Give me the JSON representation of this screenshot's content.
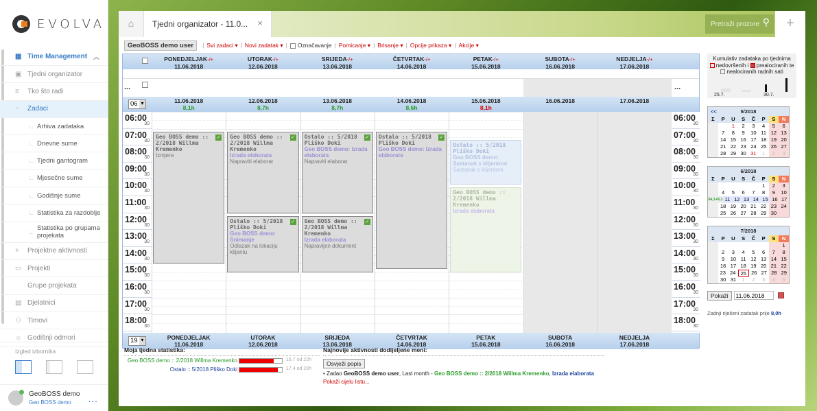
{
  "brand": {
    "name": "EVOLVA"
  },
  "sidebar": {
    "section": "Time Management",
    "items": [
      {
        "label": "Tjedni organizator",
        "type": "top-sub",
        "icon": "calendar-check-icon"
      },
      {
        "label": "Tko što radi",
        "type": "top-sub",
        "icon": "list-icon"
      },
      {
        "label": "Zadaci",
        "type": "active",
        "icon": "minus-icon"
      },
      {
        "label": "Arhiva zadataka",
        "type": "sub"
      },
      {
        "label": "Dnevne sume",
        "type": "sub"
      },
      {
        "label": "Tjedni gantogram",
        "type": "sub"
      },
      {
        "label": "Mjesečne sume",
        "type": "sub"
      },
      {
        "label": "Godišnje sume",
        "type": "sub"
      },
      {
        "label": "Statistika za razdoblje",
        "type": "sub"
      },
      {
        "label": "Statistika po grupama projekata",
        "type": "sub"
      },
      {
        "label": "Projektne aktivnosti",
        "type": "top-sub",
        "icon": "plus-icon"
      },
      {
        "label": "Projekti",
        "type": "top-sub",
        "icon": "projects-icon"
      },
      {
        "label": "Grupe projekata",
        "type": "top-sub",
        "icon": ""
      },
      {
        "label": "Djelatnici",
        "type": "top-sub",
        "icon": "employee-icon"
      },
      {
        "label": "Timovi",
        "type": "top-sub",
        "icon": "team-icon"
      },
      {
        "label": "Godišnji odmori",
        "type": "top-sub",
        "icon": "sun-icon"
      }
    ],
    "layout_label": "Izgled izbornika",
    "user": {
      "name": "GeoBOSS demo",
      "sub": "Geo BOSS demo",
      "more": "..."
    }
  },
  "tabs": {
    "title": "Tjedni organizator - 11.0...",
    "close": "×",
    "search_placeholder": "Pretraži prozore",
    "add": "+"
  },
  "toolbar": {
    "user": "GeoBOSS demo user",
    "items": [
      "Svi zadaci ▾",
      "Novi zadatak ▾",
      "Označavanje",
      "Pomicanje ▾",
      "Brisanje ▾",
      "Opcije prikaza ▾",
      "Akcije ▾"
    ]
  },
  "days": [
    {
      "name": "PONEDJELJAK",
      "date": "11.06.2018",
      "hours": "8,1h",
      "hcolor": "g"
    },
    {
      "name": "UTORAK",
      "date": "12.06.2018",
      "hours": "8,7h",
      "hcolor": "g"
    },
    {
      "name": "SRIJEDA",
      "date": "13.06.2018",
      "hours": "8,7h",
      "hcolor": "g"
    },
    {
      "name": "ČETVRTAK",
      "date": "14.06.2018",
      "hours": "8,6h",
      "hcolor": "g"
    },
    {
      "name": "PETAK",
      "date": "15.06.2018",
      "hours": "8,1h",
      "hcolor": "r"
    },
    {
      "name": "SUBOTA",
      "date": "16.06.2018",
      "hours": "",
      "hcolor": "g"
    },
    {
      "name": "NEDJELJA",
      "date": "17.06.2018",
      "hours": "",
      "hcolor": "g"
    }
  ],
  "footer_days": [
    "PONEDJELJAK",
    "UTORAK",
    "SRIJEDA",
    "ČETVRTAK",
    "PETAK",
    "SUBOTA",
    "NEDJELJA"
  ],
  "adj": "-/+",
  "dots": "...",
  "start_hour_select": "06",
  "end_hour_select": "19",
  "hours": [
    "06:00",
    "07:00",
    "08:00",
    "09:00",
    "10:00",
    "11:00",
    "12:00",
    "13:00",
    "14:00",
    "15:00",
    "16:00",
    "17:00",
    "18:00"
  ],
  "half": "30",
  "tasks": [
    {
      "day": 0,
      "start": 7.0,
      "end": 15.0,
      "title": "Geo BOSS demo :: 2/2018 Willma Kremenko",
      "label": "",
      "desc": "Izmjera",
      "ok": true,
      "style": ""
    },
    {
      "day": 1,
      "start": 7.0,
      "end": 12.0,
      "title": "Geo BOSS demo :: 2/2018 Willma Kremenko",
      "label": "Izrada elaborata",
      "desc": "Napraviti elaborat",
      "ok": true,
      "style": ""
    },
    {
      "day": 1,
      "start": 12.0,
      "end": 15.5,
      "title": "Ostalo :: 5/2018 Pliško Doki",
      "label": "Geo BOSS demo: Snimanje",
      "desc": "Odlazak na lokaciju klijentu",
      "ok": true,
      "style": ""
    },
    {
      "day": 2,
      "start": 7.0,
      "end": 12.0,
      "title": "Ostalo :: 5/2018 Pliško Doki",
      "label": "Geo BOSS demo: Izrada elaborata",
      "desc": "Napraviti elaborat",
      "ok": true,
      "style": ""
    },
    {
      "day": 2,
      "start": 12.0,
      "end": 15.5,
      "title": "Geo BOSS demo :: 2/2018 Willma Kremenko",
      "label": "Izrada elaborata",
      "desc": "Napravljen dokument",
      "ok": true,
      "style": ""
    },
    {
      "day": 3,
      "start": 7.0,
      "end": 15.3,
      "title": "Ostalo :: 5/2018 Pliško Doki",
      "label": "Geo BOSS demo: Izrada elaborata",
      "desc": "",
      "ok": true,
      "style": ""
    },
    {
      "day": 4,
      "start": 7.5,
      "end": 10.3,
      "title": "Ostalo :: 5/2018 Pliško Doki",
      "label": "Geo BOSS demo: Sastanak s klijentom",
      "desc": "Sastanak s klijentom",
      "ok": false,
      "style": "light"
    },
    {
      "day": 4,
      "start": 10.3,
      "end": 15.5,
      "title": "Geo BOSS demo :: 2/2018 Willma Kremenko",
      "label": "Izrada elaborata",
      "desc": "",
      "ok": false,
      "style": "lg"
    }
  ],
  "stats": {
    "title": "Moja tjedna statistika:",
    "rows": [
      {
        "label": "Geo BOSS demo :: 2/2018 Willma Kremenko",
        "fraction": 0.8,
        "value": "16.7 od 22h",
        "color": "#2a9a2a"
      },
      {
        "label": "Ostalo :: 5/2018 Pliško Doki",
        "fraction": 0.9,
        "value": "17.4 od 20h",
        "color": "#1a3f9a"
      }
    ]
  },
  "activity": {
    "title": "Najnovije aktivnosti dodijeljene meni:",
    "refresh": "Osvježi popis",
    "line_prefix": "• Zadao ",
    "line_user": "GeoBOSS demo user",
    "line_mid": ", Last month - ",
    "line_proj": "Geo BOSS demo :: 2/2018 Willma Kremenko",
    "line_sep": ", ",
    "line_task": "Izrada elaborata",
    "show_all": "Pokaži cijelu listu..."
  },
  "right": {
    "cumul_title": "Kumulativ zadataka po tjednima",
    "legend1": "nedovršenih i",
    "legend2": "prealociranih te",
    "legend3": "nealociranih radnih sati",
    "bar_labels": [
      "25.7.",
      "30.7."
    ],
    "bar_levels": [
      0.2,
      0.1,
      0.5,
      0.9
    ],
    "show_btn": "Pokaži",
    "date_value": "11.06.2018",
    "last_solved": "Zadnji riješeni zadatak prije",
    "last_solved_val": "8,0h",
    "cal_nav": "<<",
    "dow": [
      "Σ",
      "P",
      "U",
      "S",
      "Č",
      "P",
      "S",
      "N"
    ],
    "cal5_title": "5/2018",
    "cal5": [
      [
        "",
        "",
        "1",
        "2",
        "3",
        "4",
        "5",
        "6"
      ],
      [
        "",
        "7",
        "8",
        "9",
        "10",
        "11",
        "12",
        "13"
      ],
      [
        "",
        "14",
        "15",
        "16",
        "17",
        "18",
        "19",
        "20"
      ],
      [
        "",
        "21",
        "22",
        "23",
        "24",
        "25",
        "26",
        "27"
      ],
      [
        "",
        "28",
        "29",
        "30",
        "31",
        "1",
        "2",
        "3"
      ]
    ],
    "cal6_title": "6/2018",
    "cal6": [
      [
        "",
        "",
        "",
        "",
        "",
        "1",
        "2",
        "3"
      ],
      [
        "",
        "4",
        "5",
        "6",
        "7",
        "8",
        "9",
        "10"
      ],
      [
        "34,1+8,1",
        "11",
        "12",
        "13",
        "14",
        "15",
        "16",
        "17"
      ],
      [
        "",
        "18",
        "19",
        "20",
        "21",
        "22",
        "23",
        "24"
      ],
      [
        "",
        "25",
        "26",
        "27",
        "28",
        "29",
        "30",
        ""
      ]
    ],
    "cal7_title": "7/2018",
    "cal7": [
      [
        "",
        "",
        "",
        "",
        "",
        "",
        "",
        "1"
      ],
      [
        "",
        "2",
        "3",
        "4",
        "5",
        "6",
        "7",
        "8"
      ],
      [
        "",
        "9",
        "10",
        "11",
        "12",
        "13",
        "14",
        "15"
      ],
      [
        "",
        "16",
        "17",
        "18",
        "19",
        "20",
        "21",
        "22"
      ],
      [
        "",
        "23",
        "24",
        "25",
        "26",
        "27",
        "28",
        "29"
      ],
      [
        "",
        "30",
        "31",
        "1",
        "2",
        "3",
        "4",
        "5"
      ]
    ]
  }
}
